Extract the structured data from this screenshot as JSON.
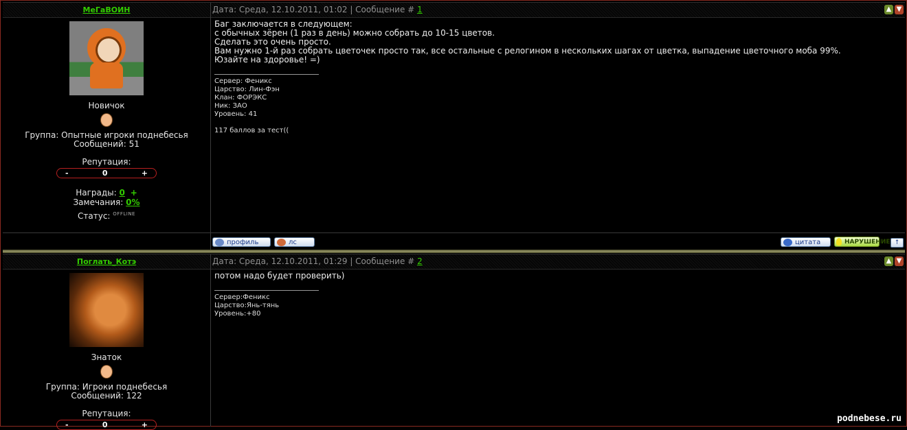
{
  "posts": [
    {
      "author": "МеГаВОИН",
      "date_prefix": "Дата: Среда, 12.10.2011, 01:02 | Сообщение #",
      "number": "1",
      "rank": "Новичок",
      "group": "Группа: Опытные игроки поднебесья",
      "messages": "Сообщений: 51",
      "reputation_label": "Репутация:",
      "reputation_value": "0",
      "awards_label": "Награды:",
      "awards_value": "0",
      "awards_plus": "+",
      "warnings_label": "Замечания:",
      "warnings_value": "0%",
      "status_label": "Статус:",
      "status_value": "OFFLINE",
      "body_lines": [
        "Баг заключается в следующем:",
        "с обычных зёрен (1 раз в день) можно собрать до 10-15 цветов.",
        "Сделать это очень просто.",
        "Вам нужно 1-й раз собрать цветочек просто так, все остальные с релогином в нескольких шагах от цветка, выпадение цветочного моба 99%.",
        "Юзайте на здоровье! =)"
      ],
      "signature_lines": [
        "Сервер: Феникс",
        "Царство: Лин-Фэн",
        "Клан: ФОРЭКС",
        "Ник: ЗАО",
        "Уровень: 41",
        "",
        "117 баллов за тест(("
      ]
    },
    {
      "author": "Поглать_Котэ",
      "date_prefix": "Дата: Среда, 12.10.2011, 01:29 | Сообщение #",
      "number": "2",
      "rank": "Знаток",
      "group": "Группа: Игроки поднебесья",
      "messages": "Сообщений: 122",
      "reputation_label": "Репутация:",
      "reputation_value": "0",
      "body_lines": [
        "потом надо будет проверить)"
      ],
      "signature_lines": [
        "Сервер:Феникс",
        "Царство:Янь-тянь",
        "Уровень:+80"
      ]
    }
  ],
  "buttons": {
    "profile": "профиль",
    "pm": "лс",
    "quote": "цитата",
    "violation": "НАРУШЕНИЕ",
    "up": "↑"
  },
  "rep_minus": "-",
  "rep_plus": "+",
  "watermark": "podnebese.ru"
}
